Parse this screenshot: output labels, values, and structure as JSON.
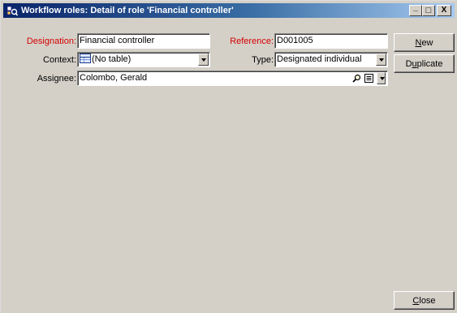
{
  "window": {
    "title": "Workflow roles: Detail of role 'Financial controller'",
    "minimize_glyph": "_",
    "maximize_glyph": "□",
    "close_glyph": "X"
  },
  "form": {
    "designation": {
      "label": "Designation:",
      "value": "Financial controller"
    },
    "reference": {
      "label": "Reference:",
      "value": "D001005"
    },
    "context": {
      "label": "Context:",
      "value": "(No table)",
      "icon": "table-icon"
    },
    "type": {
      "label": "Type:",
      "value": "Designated individual"
    },
    "assignee": {
      "label": "Assignee:",
      "value": "Colombo, Gerald"
    }
  },
  "buttons": {
    "new": {
      "accel": "N",
      "rest": "ew"
    },
    "duplicate": {
      "pre": "D",
      "accel": "u",
      "rest": "plicate"
    },
    "close": {
      "accel": "C",
      "rest": "lose"
    }
  },
  "colors": {
    "mandatory_label": "#d40000",
    "titlebar_start": "#0a246a",
    "titlebar_end": "#a6caf0",
    "face": "#d4d0c8"
  }
}
